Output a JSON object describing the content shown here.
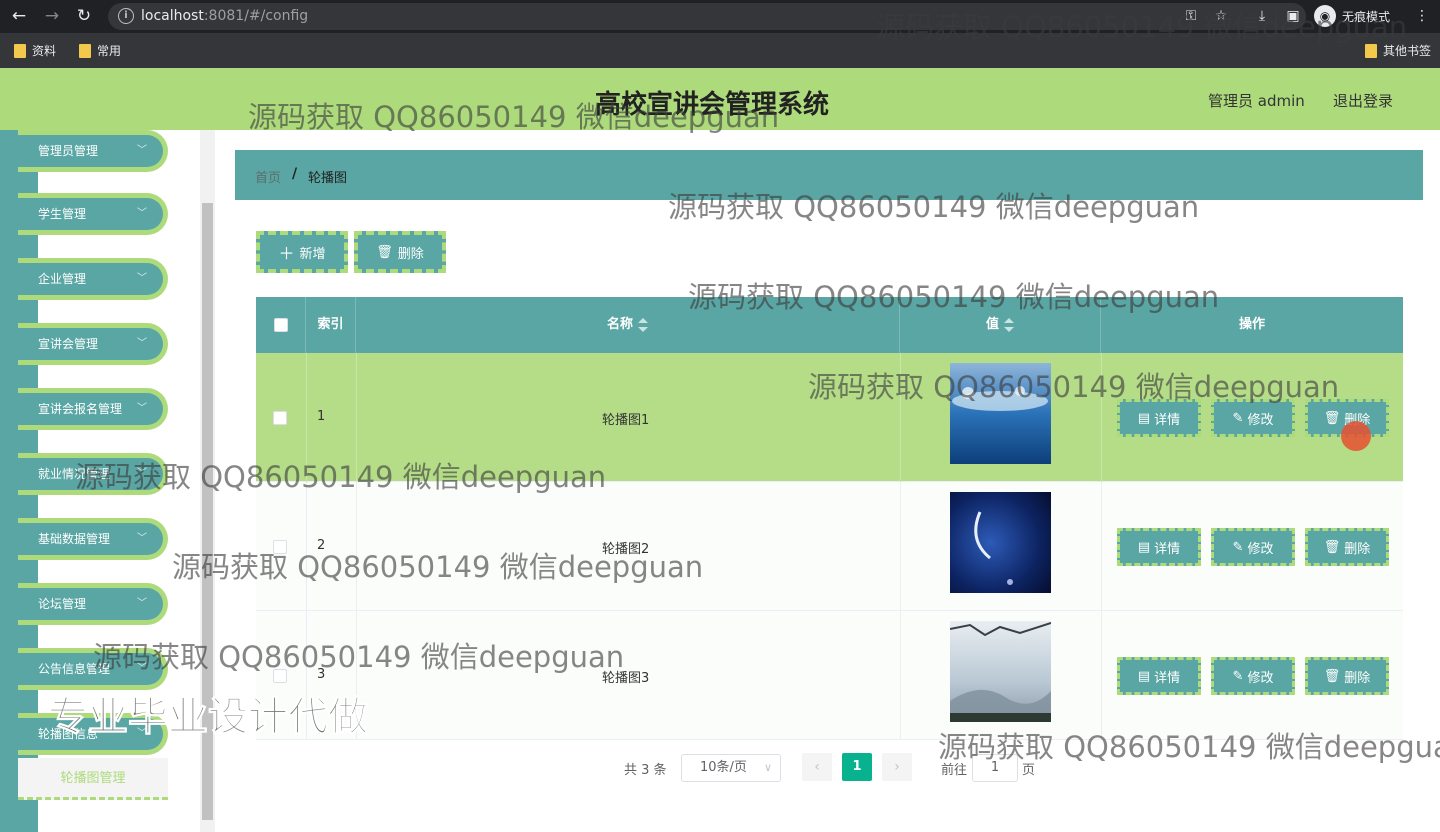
{
  "browser": {
    "url_host": "localhost",
    "url_rest": ":8081/#/config",
    "profile_label": "无痕模式",
    "bookmarks": [
      "资料",
      "常用"
    ],
    "other_bookmarks": "其他书签"
  },
  "header": {
    "title": "高校宣讲会管理系统",
    "admin_label": "管理员 admin",
    "logout_label": "退出登录"
  },
  "sidebar": {
    "items": [
      {
        "label": "管理员管理"
      },
      {
        "label": "学生管理"
      },
      {
        "label": "企业管理"
      },
      {
        "label": "宣讲会管理"
      },
      {
        "label": "宣讲会报名管理"
      },
      {
        "label": "就业情况管理"
      },
      {
        "label": "基础数据管理"
      },
      {
        "label": "论坛管理"
      },
      {
        "label": "公告信息管理"
      },
      {
        "label": "轮播图信息"
      }
    ],
    "active_sub_item": "轮播图管理"
  },
  "breadcrumb": {
    "home": "首页",
    "separator": "/",
    "current": "轮播图"
  },
  "toolbar": {
    "add_label": "新增",
    "delete_label": "删除"
  },
  "table": {
    "columns": [
      "索引",
      "名称",
      "值",
      "操作"
    ],
    "rows": [
      {
        "index": "1",
        "name": "轮播图1",
        "image": "blue-water-photo"
      },
      {
        "index": "2",
        "name": "轮播图2",
        "image": "dark-night-sky-photo"
      },
      {
        "index": "3",
        "name": "轮播图3",
        "image": "misty-landscape-photo"
      }
    ],
    "actions": {
      "detail": "详情",
      "edit": "修改",
      "delete": "删除"
    }
  },
  "pagination": {
    "total": "共 3 条",
    "page_size": "10条/页",
    "current_page": "1",
    "goto_label": "前往",
    "goto_value": "1",
    "goto_suffix": "页"
  },
  "watermarks": {
    "text": "源码获取 QQ86050149 微信deepguan",
    "cut_text": "源码获取 QQ86050149 微信deepgua",
    "big_text": "专业毕业设计代做"
  },
  "colors": {
    "accent_green": "#addb7c",
    "teal": "#5aa6a4",
    "pager_active": "#09b28f"
  }
}
